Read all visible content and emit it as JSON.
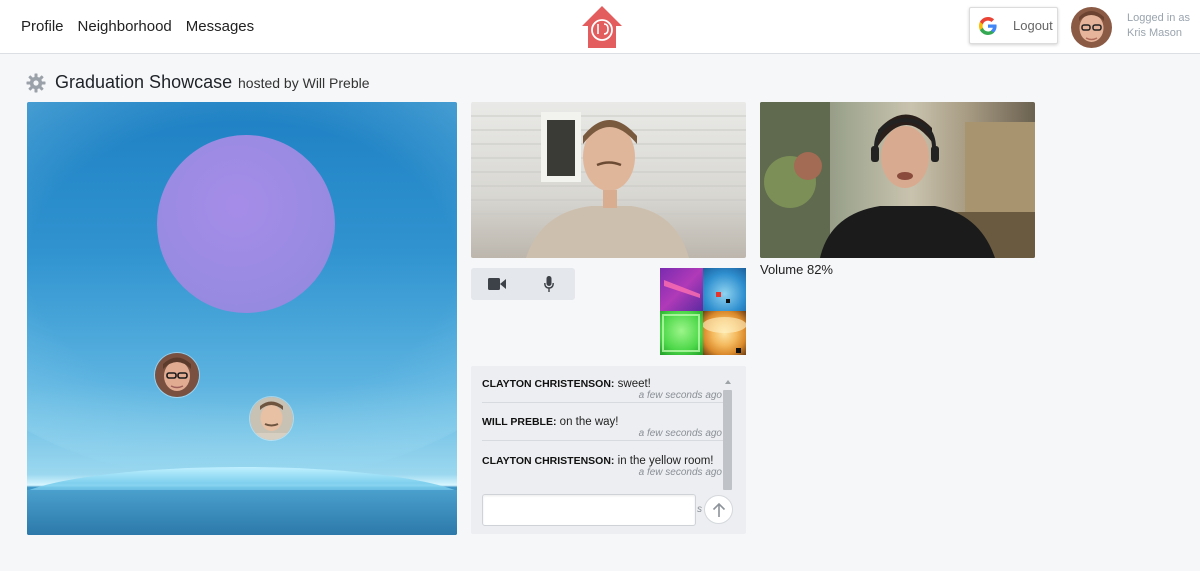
{
  "nav": {
    "items": [
      {
        "label": "Profile"
      },
      {
        "label": "Neighborhood"
      },
      {
        "label": "Messages"
      }
    ]
  },
  "header": {
    "logo_icon": "house-logo-icon",
    "logout_label": "Logout",
    "login_status": "Logged in as",
    "user_name": "Kris Mason"
  },
  "event": {
    "settings_icon": "gear-icon",
    "title": "Graduation Showcase",
    "hosted_by": "hosted by Will Preble"
  },
  "video_tiles": [
    {
      "name": "participant-video"
    },
    {
      "name": "participant-video",
      "volume_label": "Volume 82%"
    }
  ],
  "controls": {
    "camera_icon": "video-camera-icon",
    "mic_icon": "microphone-icon"
  },
  "chat": {
    "messages": [
      {
        "sender": "CLAYTON CHRISTENSON:",
        "text": " sweet!",
        "time": "a few seconds ago"
      },
      {
        "sender": "WILL PREBLE:",
        "text": " on the way!",
        "time": "a few seconds ago"
      },
      {
        "sender": "CLAYTON CHRISTENSON:",
        "text": " in the yellow room!",
        "time": "a few seconds ago"
      }
    ],
    "input_placeholder": "",
    "stray_text": "s",
    "send_icon": "arrow-up-icon"
  },
  "colors": {
    "accent_red": "#e0585a",
    "chat_bg": "#eceef1",
    "page_bg": "#f6f7f9"
  }
}
